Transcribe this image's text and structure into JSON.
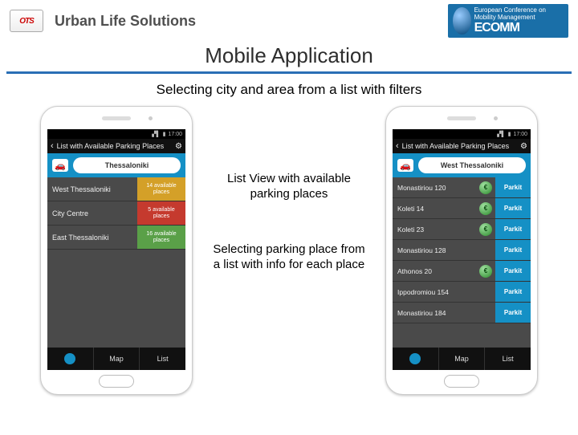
{
  "header": {
    "ots_logo_text": "OTS",
    "uls": "Urban Life Solutions",
    "ecomm_small": "European Conference on Mobility Management",
    "ecomm_big": "ECOMM"
  },
  "title": "Mobile Application",
  "subtitle": "Selecting city and area from a list with filters",
  "captions": {
    "c1": "List View with available parking places",
    "c2": "Selecting parking place from a list with info for each place"
  },
  "phone_common": {
    "status_time": "17:00",
    "appbar_title": "List with Available Parking Places",
    "tabs": {
      "map": "Map",
      "list": "List"
    },
    "car_glyph": "🚗",
    "parkit_label": "Parkit",
    "euro_glyph": "€"
  },
  "phone_left": {
    "city": "Thessaloniki",
    "rows": [
      {
        "name": "West Thessaloniki",
        "count": "14 available",
        "sub": "places",
        "cls": "bg-yel"
      },
      {
        "name": "City Centre",
        "count": "5 available",
        "sub": "places",
        "cls": "bg-red"
      },
      {
        "name": "East Thessaloniki",
        "count": "16 available",
        "sub": "places",
        "cls": "bg-grn"
      }
    ]
  },
  "phone_right": {
    "city": "West Thessaloniki",
    "rows": [
      {
        "name": "Monastiriou 120",
        "euro": true
      },
      {
        "name": "Koleti 14",
        "euro": true
      },
      {
        "name": "Koleti 23",
        "euro": true
      },
      {
        "name": "Monastiriou 128",
        "euro": false
      },
      {
        "name": "Athonos 20",
        "euro": true
      },
      {
        "name": "Ippodromiou 154",
        "euro": false
      },
      {
        "name": "Monastiriou 184",
        "euro": false
      }
    ]
  }
}
